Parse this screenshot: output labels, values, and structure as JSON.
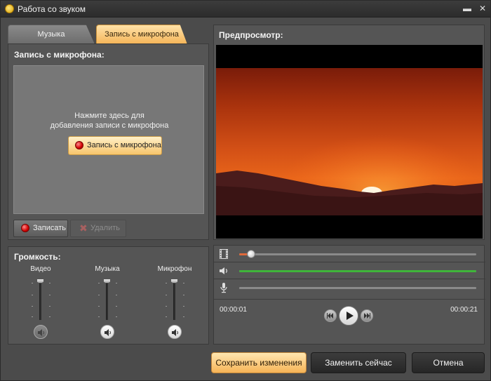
{
  "window": {
    "title": "Работа со звуком",
    "minimize_icon": "minimize-icon",
    "close_icon": "close-icon"
  },
  "tabs": [
    {
      "label": "Музыка",
      "active": false
    },
    {
      "label": "Запись с микрофона",
      "active": true
    }
  ],
  "mic_panel": {
    "heading": "Запись с микрофона:",
    "hint_line1": "Нажмите здесь для",
    "hint_line2": "добавления записи с микрофона",
    "record_center_label": "Запись с микрофона",
    "record_button_label": "Записать",
    "delete_button_label": "Удалить"
  },
  "volume": {
    "heading": "Громкость:",
    "channels": [
      {
        "label": "Видео",
        "level": 1.0,
        "muted": true
      },
      {
        "label": "Музыка",
        "level": 1.0,
        "muted": false
      },
      {
        "label": "Микрофон",
        "level": 1.0,
        "muted": false
      }
    ]
  },
  "preview": {
    "heading": "Предпросмотр:",
    "time_current": "00:00:01",
    "time_total": "00:00:21",
    "progress": 0.05,
    "tracks": [
      {
        "icon": "film-icon",
        "color": "#e0693a"
      },
      {
        "icon": "speaker-icon",
        "color": "#3fb53a"
      },
      {
        "icon": "microphone-icon",
        "color": "#8a8a8a"
      }
    ]
  },
  "footer": {
    "save_label": "Сохранить изменения",
    "replace_label": "Заменить сейчас",
    "cancel_label": "Отмена"
  },
  "colors": {
    "accent": "#f6b457",
    "record_red": "#d10000",
    "audio_green": "#3fb53a"
  }
}
